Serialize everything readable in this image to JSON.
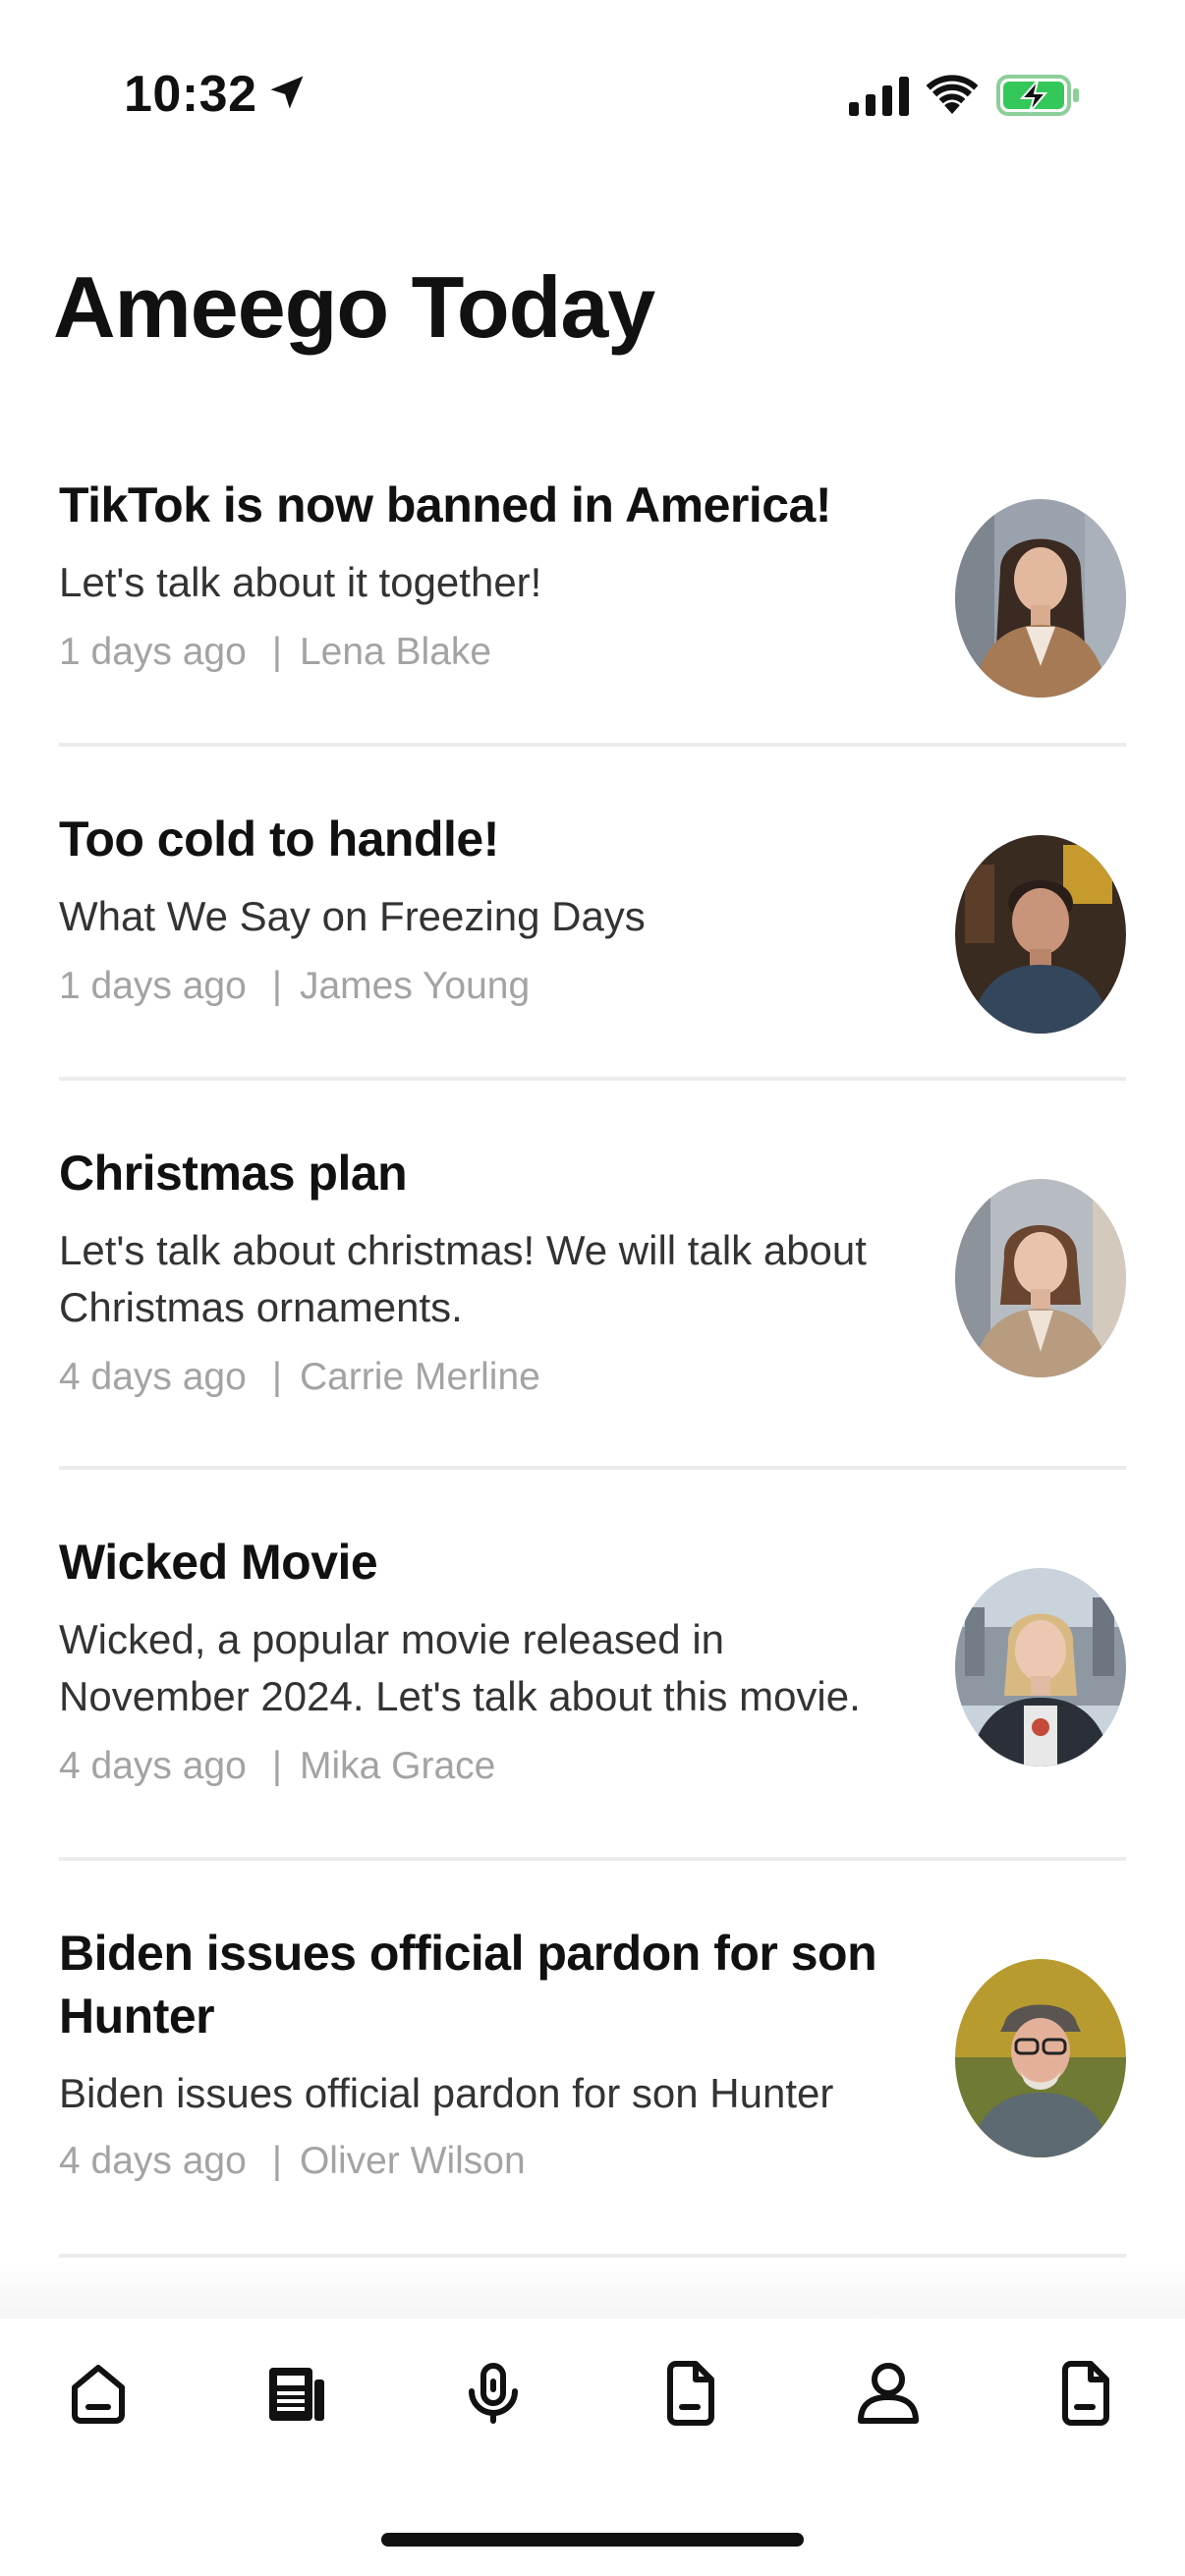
{
  "status_bar": {
    "time": "10:32"
  },
  "page": {
    "title": "Ameego Today"
  },
  "posts": [
    {
      "title": "TikTok is now banned in America!",
      "subtitle": "Let's talk about it together!",
      "age": "1 days ago",
      "author": "Lena Blake"
    },
    {
      "title": "Too cold to handle!",
      "subtitle": "What We Say on Freezing Days",
      "age": "1 days ago",
      "author": "James Young"
    },
    {
      "title": "Christmas plan",
      "subtitle": "Let's talk about christmas! We will talk about Christmas ornaments.",
      "age": "4 days ago",
      "author": "Carrie Merline"
    },
    {
      "title": "Wicked Movie",
      "subtitle": "Wicked, a popular movie released in November 2024. Let's talk about this movie.",
      "age": "4 days ago",
      "author": "Mika Grace"
    },
    {
      "title": "Biden issues official pardon for son Hunter",
      "subtitle": "Biden issues official pardon for son Hunter",
      "age": "4 days ago",
      "author": "Oliver Wilson"
    }
  ],
  "meta_separator": "|",
  "tab_bar": {
    "tabs": [
      {
        "icon": "home-icon"
      },
      {
        "icon": "newspaper-icon"
      },
      {
        "icon": "microphone-icon"
      },
      {
        "icon": "document-icon"
      },
      {
        "icon": "profile-icon"
      },
      {
        "icon": "document-icon"
      }
    ]
  },
  "colors": {
    "meta_text": "#a3a3a3",
    "divider": "#ececec",
    "battery_green": "#34c759"
  }
}
